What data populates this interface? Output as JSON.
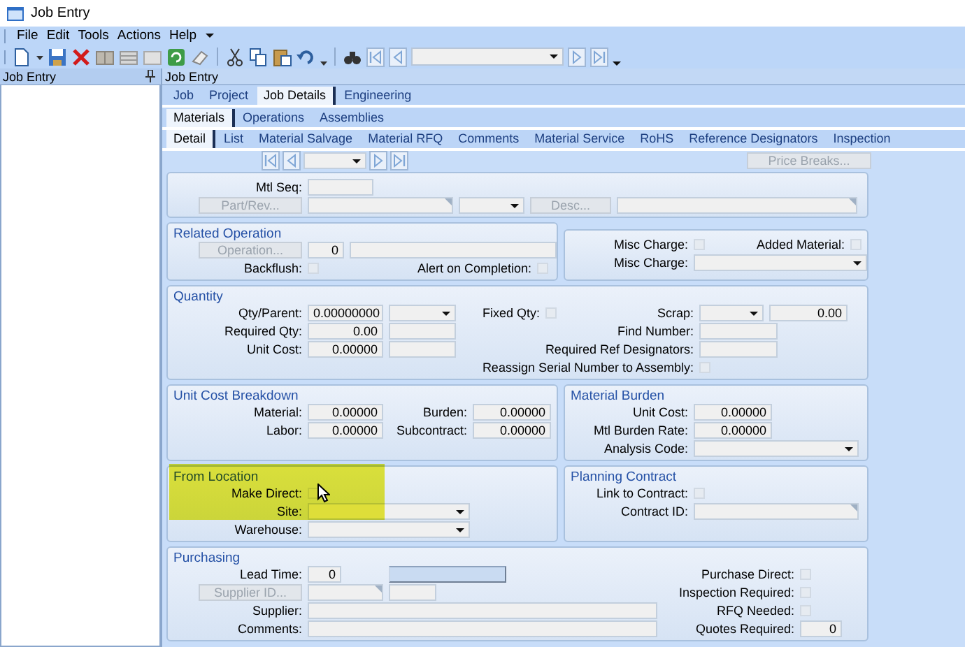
{
  "window": {
    "title": "Job Entry"
  },
  "menu": [
    "File",
    "Edit",
    "Tools",
    "Actions",
    "Help"
  ],
  "left_panel": {
    "title": "Job Entry"
  },
  "main_panel": {
    "title": "Job Entry"
  },
  "tab_rows": [
    [
      {
        "label": "Job",
        "selected": false
      },
      {
        "label": "Project",
        "selected": false
      },
      {
        "label": "Job Details",
        "selected": true
      },
      {
        "label": "Engineering",
        "selected": false
      }
    ],
    [
      {
        "label": "Materials",
        "selected": true
      },
      {
        "label": "Operations",
        "selected": false
      },
      {
        "label": "Assemblies",
        "selected": false
      }
    ],
    [
      {
        "label": "Detail",
        "selected": true
      },
      {
        "label": "List",
        "selected": false
      },
      {
        "label": "Material Salvage",
        "selected": false
      },
      {
        "label": "Material RFQ",
        "selected": false
      },
      {
        "label": "Comments",
        "selected": false
      },
      {
        "label": "Material Service",
        "selected": false
      },
      {
        "label": "RoHS",
        "selected": false
      },
      {
        "label": "Reference Designators",
        "selected": false
      },
      {
        "label": "Inspection",
        "selected": false
      }
    ]
  ],
  "form": {
    "price_breaks": {
      "label": "Price Breaks...",
      "disabled": true
    },
    "groups": [
      {
        "rows": [
          [
            {
              "kind": "label",
              "text": "Mtl Seq:"
            },
            {
              "kind": "field"
            }
          ],
          [
            {
              "kind": "button",
              "label": "Part/Rev...",
              "disabled": true
            },
            {
              "kind": "lookup"
            },
            {
              "kind": "combo"
            },
            {
              "kind": "button",
              "label": "Desc...",
              "disabled": true
            },
            {
              "kind": "lookup"
            }
          ]
        ]
      },
      {
        "title": "Related Operation",
        "rows": [
          [
            {
              "kind": "button",
              "label": "Operation...",
              "disabled": true
            },
            {
              "kind": "field",
              "value": "0"
            },
            {
              "kind": "field"
            }
          ],
          [
            {
              "kind": "label",
              "text": "Backflush:"
            },
            {
              "kind": "check",
              "checked": false
            },
            {
              "kind": "label",
              "text": "Alert on Completion:"
            },
            {
              "kind": "check",
              "checked": false
            }
          ]
        ]
      },
      {
        "rows": [
          [
            {
              "kind": "label",
              "text": "Misc Charge:"
            },
            {
              "kind": "check",
              "checked": false
            },
            {
              "kind": "label",
              "text": "Added Material:"
            },
            {
              "kind": "check",
              "checked": false
            }
          ],
          [
            {
              "kind": "label",
              "text": "Misc Charge:"
            },
            {
              "kind": "combo"
            }
          ]
        ]
      },
      {
        "title": "Quantity",
        "rows": [
          [
            {
              "kind": "label",
              "text": "Qty/Parent:"
            },
            {
              "kind": "field",
              "value": "0.00000000"
            },
            {
              "kind": "combo"
            },
            {
              "kind": "label",
              "text": "Fixed Qty:"
            },
            {
              "kind": "check",
              "checked": false
            },
            {
              "kind": "label",
              "text": "Scrap:"
            },
            {
              "kind": "combo"
            },
            {
              "kind": "field",
              "value": "0.00"
            }
          ],
          [
            {
              "kind": "label",
              "text": "Required Qty:"
            },
            {
              "kind": "field",
              "value": "0.00"
            },
            {
              "kind": "field"
            },
            {
              "kind": "label",
              "text": "Find Number:"
            },
            {
              "kind": "field"
            }
          ],
          [
            {
              "kind": "label",
              "text": "Unit Cost:"
            },
            {
              "kind": "field",
              "value": "0.00000"
            },
            {
              "kind": "field"
            },
            {
              "kind": "label",
              "text": "Required Ref Designators:"
            },
            {
              "kind": "field"
            }
          ],
          [
            {
              "kind": "empty"
            },
            {
              "kind": "empty"
            },
            {
              "kind": "empty"
            },
            {
              "kind": "label",
              "text": "Reassign Serial Number to Assembly:"
            },
            {
              "kind": "check",
              "checked": false
            }
          ]
        ]
      },
      {
        "title": "Unit Cost Breakdown",
        "rows": [
          [
            {
              "kind": "label",
              "text": "Material:"
            },
            {
              "kind": "field",
              "value": "0.00000"
            },
            {
              "kind": "label",
              "text": "Burden:"
            },
            {
              "kind": "field",
              "value": "0.00000"
            }
          ],
          [
            {
              "kind": "label",
              "text": "Labor:"
            },
            {
              "kind": "field",
              "value": "0.00000"
            },
            {
              "kind": "label",
              "text": "Subcontract:"
            },
            {
              "kind": "field",
              "value": "0.00000"
            }
          ]
        ]
      },
      {
        "title": "Material Burden",
        "rows": [
          [
            {
              "kind": "label",
              "text": "Unit Cost:"
            },
            {
              "kind": "field",
              "value": "0.00000"
            }
          ],
          [
            {
              "kind": "label",
              "text": "Mtl Burden Rate:"
            },
            {
              "kind": "field",
              "value": "0.00000"
            }
          ],
          [
            {
              "kind": "label",
              "text": "Analysis Code:"
            },
            {
              "kind": "combo"
            }
          ]
        ]
      },
      {
        "title": "From Location",
        "highlighted": true,
        "rows": [
          [
            {
              "kind": "label",
              "text": "Make Direct:"
            },
            {
              "kind": "check",
              "checked": false
            }
          ],
          [
            {
              "kind": "label",
              "text": "Site:"
            },
            {
              "kind": "combo"
            }
          ],
          [
            {
              "kind": "label",
              "text": "Warehouse:"
            },
            {
              "kind": "combo"
            }
          ]
        ]
      },
      {
        "title": "Planning Contract",
        "rows": [
          [
            {
              "kind": "label",
              "text": "Link to Contract:"
            },
            {
              "kind": "check",
              "checked": false
            }
          ],
          [
            {
              "kind": "label",
              "text": "Contract ID:"
            },
            {
              "kind": "lookup"
            }
          ]
        ]
      },
      {
        "title": "Purchasing",
        "rows": [
          [
            {
              "kind": "label",
              "text": "Lead Time:"
            },
            {
              "kind": "field",
              "value": "0"
            },
            {
              "kind": "button",
              "disabled": false
            },
            {
              "kind": "label",
              "text": "Purchase Direct:"
            },
            {
              "kind": "check",
              "checked": false
            }
          ],
          [
            {
              "kind": "button",
              "label": "Supplier ID...",
              "disabled": true
            },
            {
              "kind": "lookup"
            },
            {
              "kind": "field"
            },
            {
              "kind": "label",
              "text": "Inspection  Required:"
            },
            {
              "kind": "check",
              "checked": false
            }
          ],
          [
            {
              "kind": "label",
              "text": "Supplier:"
            },
            {
              "kind": "field"
            },
            {
              "kind": "label",
              "text": "RFQ Needed:"
            },
            {
              "kind": "check",
              "checked": false
            }
          ],
          [
            {
              "kind": "label",
              "text": "Comments:"
            },
            {
              "kind": "field"
            },
            {
              "kind": "label",
              "text": "Quotes Required:"
            },
            {
              "kind": "field",
              "value": "0"
            }
          ]
        ]
      }
    ]
  }
}
